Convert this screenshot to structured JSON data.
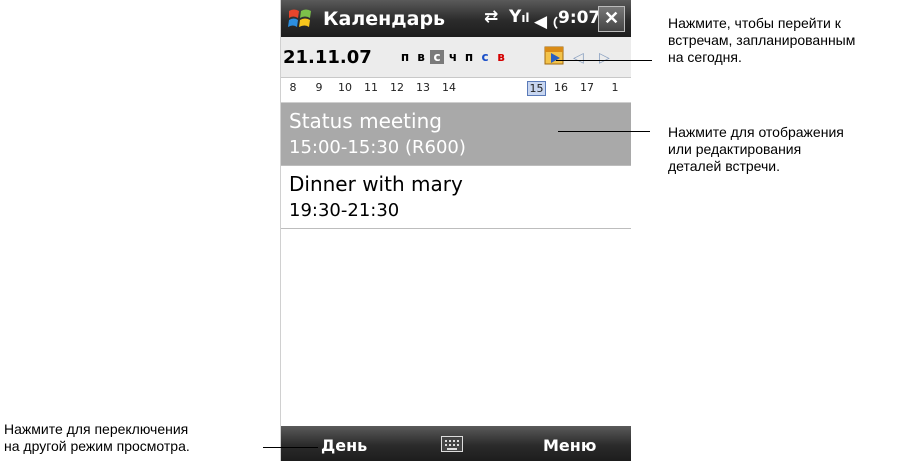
{
  "titlebar": {
    "app_title": "Календарь",
    "time": "9:07",
    "close_label": "✕",
    "sync_icon": "sync-arrows-icon",
    "signal_icon": "signal-icon",
    "volume_icon": "speaker-icon"
  },
  "datebar": {
    "date": "21.11.07",
    "weekdays": [
      "п",
      "в",
      "с",
      "ч",
      "п",
      "с",
      "в"
    ],
    "selected_weekday_index": 2,
    "weekend_color": "#d40000"
  },
  "hours": [
    "8",
    "9",
    "10",
    "11",
    "12",
    "13",
    "14",
    "15",
    "16",
    "17",
    "1"
  ],
  "current_hour": "15",
  "appointments": [
    {
      "title": "Status meeting",
      "details": "15:00-15:30 (R600)"
    },
    {
      "title": "Dinner with mary",
      "details": "19:30-21:30"
    }
  ],
  "softkeys": {
    "left": "День",
    "right": "Меню"
  },
  "callouts": {
    "today_line1": "Нажмите, чтобы перейти к",
    "today_line2": "встречам, запланированным",
    "today_line3": "на сегодня.",
    "appt_line1": "Нажмите для отображения",
    "appt_line2": "или редактирования",
    "appt_line3": "деталей встречи.",
    "view_line1": "Нажмите для переключения",
    "view_line2": "на другой режим просмотра."
  }
}
